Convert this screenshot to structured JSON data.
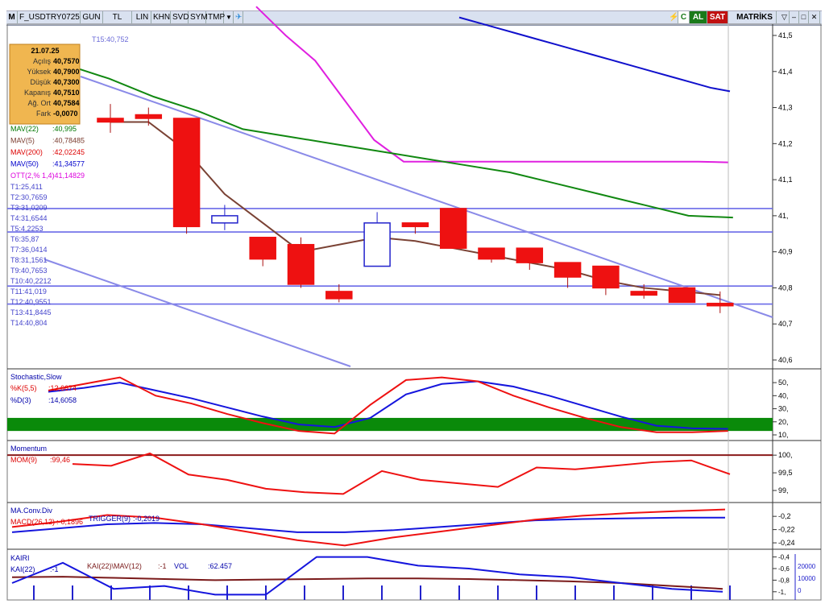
{
  "toolbar": {
    "m_label": "M",
    "symbol": "F_USDTRY0725",
    "period": "GUN",
    "currency": "TL",
    "buttons": [
      "LIN",
      "KHN",
      "SVD",
      "SYM",
      "TMP"
    ],
    "c_label": "C",
    "al_label": "AL",
    "sat_label": "SAT",
    "matriks_label": "MATRİKS",
    "colors": {
      "al": "#1a7a1a",
      "sat": "#c01010",
      "strip": "#d9e1f0"
    }
  },
  "info_box": {
    "date": "21.07.25",
    "rows": [
      {
        "label": "Açılış",
        "value": "40,7570"
      },
      {
        "label": "Yüksek",
        "value": "40,7900"
      },
      {
        "label": "Düşük",
        "value": "40,7300"
      },
      {
        "label": "Kapanış",
        "value": "40,7510"
      },
      {
        "label": "Ağ. Ort",
        "value": "40,7584"
      },
      {
        "label": "Fark",
        "value": "-0,0070"
      }
    ]
  },
  "price_panel": {
    "line_label": "T15:40,752",
    "indicator_labels": [
      {
        "text": "MAV(22)",
        "value": ":40,995",
        "color": "#007700"
      },
      {
        "text": "MAV(5)",
        "value": ":40,78485",
        "color": "#7a3b2e"
      },
      {
        "text": "MAV(200)",
        "value": ":42,02245",
        "color": "#dd0000"
      },
      {
        "text": "MAV(50)",
        "value": ":41,34577",
        "color": "#0000cc"
      },
      {
        "text": "OTT(2,% 1,4)",
        "value": ":41,14829",
        "color": "#dd00dd"
      }
    ],
    "t_levels": [
      "T1:25,411",
      "T2:30,7659",
      "T3:31,0209",
      "T4:31,6544",
      "T5:4,2253",
      "T6:35,87",
      "T7:36,0414",
      "T8:31,1561",
      "T9:40,7653",
      "T10:40,2212",
      "T11:41,019",
      "T12:40,9551",
      "T13:41,8445",
      "T14:40,804"
    ]
  },
  "stoch_panel": {
    "title": "Stochastic,Slow",
    "k_label": "%K(5,5)",
    "k_value": ":12,6674",
    "d_label": "%D(3)",
    "d_value": ":14,6058"
  },
  "mom_panel": {
    "title": "Momentum",
    "label": "MOM(9)",
    "value": ":99,46"
  },
  "macd_panel": {
    "title": "MA.Conv.Div",
    "macd_label": "MACD(26,12)",
    "macd_value": ":-0,1896",
    "trig_label": "TRIGGER(9)",
    "trig_value": ":-0,2019"
  },
  "kairi_panel": {
    "title": "KAIRI",
    "kai_label": "KAI(22)",
    "kai_value": ":-1",
    "kaimav_label": "KAI(22)\\MAV(12)",
    "kaimav_value": ":-1",
    "vol_label": "VOL",
    "vol_value": ":62.457"
  },
  "chart_data": [
    {
      "type": "candlestick",
      "yticks": [
        "41,5",
        "41,4",
        "41,3",
        "41,2",
        "41,1",
        "41,",
        "40,9",
        "40,8",
        "40,7",
        "40,6"
      ],
      "ylim": [
        40.585,
        41.52
      ],
      "candles": [
        {
          "open": 41.27,
          "high": 41.31,
          "low": 41.23,
          "close": 41.26
        },
        {
          "open": 41.28,
          "high": 41.3,
          "low": 41.25,
          "close": 41.27
        },
        {
          "open": 41.27,
          "high": 41.27,
          "low": 40.95,
          "close": 40.97
        },
        {
          "open": 40.98,
          "high": 41.03,
          "low": 40.96,
          "close": 41.0
        },
        {
          "open": 40.94,
          "high": 40.94,
          "low": 40.86,
          "close": 40.88
        },
        {
          "open": 40.92,
          "high": 40.94,
          "low": 40.8,
          "close": 40.81
        },
        {
          "open": 40.79,
          "high": 40.81,
          "low": 40.76,
          "close": 40.77
        },
        {
          "open": 40.86,
          "high": 41.01,
          "low": 40.86,
          "close": 40.98
        },
        {
          "open": 40.98,
          "high": 40.98,
          "low": 40.95,
          "close": 40.97
        },
        {
          "open": 41.02,
          "high": 41.02,
          "low": 40.91,
          "close": 40.91
        },
        {
          "open": 40.91,
          "high": 40.91,
          "low": 40.87,
          "close": 40.88
        },
        {
          "open": 40.91,
          "high": 40.91,
          "low": 40.85,
          "close": 40.87
        },
        {
          "open": 40.87,
          "high": 40.87,
          "low": 40.8,
          "close": 40.83
        },
        {
          "open": 40.86,
          "high": 40.86,
          "low": 40.78,
          "close": 40.8
        },
        {
          "open": 40.79,
          "high": 40.81,
          "low": 40.77,
          "close": 40.78
        },
        {
          "open": 40.8,
          "high": 40.8,
          "low": 40.76,
          "close": 40.76
        },
        {
          "open": 40.757,
          "high": 40.79,
          "low": 40.73,
          "close": 40.751
        }
      ],
      "mav5": [
        41.26,
        41.26,
        41.18,
        41.06,
        40.98,
        40.9,
        40.92,
        40.94,
        40.93,
        40.91,
        40.89,
        40.87,
        40.85,
        40.82,
        40.8,
        40.79,
        40.78
      ],
      "mav22": [
        41.44,
        41.42,
        41.38,
        41.33,
        41.29,
        41.24,
        41.22,
        41.2,
        41.18,
        41.16,
        41.14,
        41.12,
        41.09,
        41.06,
        41.03,
        41.0,
        40.995
      ],
      "ott": [
        41.58,
        41.5,
        41.43,
        41.32,
        41.21,
        41.15,
        41.15,
        41.15,
        41.15,
        41.15,
        41.15,
        41.15,
        41.15,
        41.15,
        41.15,
        41.15,
        41.148
      ],
      "mav50": [
        41.55,
        41.535,
        41.52,
        41.505,
        41.49,
        41.475,
        41.46,
        41.445,
        41.43,
        41.415,
        41.4,
        41.385,
        41.37,
        41.355,
        41.345
      ]
    },
    {
      "type": "line",
      "yticks": [
        "50,",
        "40,",
        "30,",
        "20,",
        "10,"
      ],
      "ylim": [
        10,
        55
      ],
      "k": [
        44,
        49,
        54,
        40,
        34,
        26,
        19,
        13,
        11,
        33,
        52,
        54,
        51,
        40,
        31,
        23,
        16,
        12,
        12,
        13
      ],
      "d": [
        43,
        46,
        50,
        44,
        38,
        31,
        24,
        18,
        16,
        23,
        41,
        49,
        51,
        47,
        40,
        32,
        24,
        17,
        15,
        14.6
      ]
    },
    {
      "type": "line",
      "yticks": [
        "100,",
        "99,5",
        "99,"
      ],
      "ylim": [
        98.75,
        100.3
      ],
      "mom": [
        99.75,
        99.7,
        100.05,
        99.45,
        99.3,
        99.05,
        98.95,
        98.9,
        99.55,
        99.3,
        99.2,
        99.1,
        99.65,
        99.6,
        99.7,
        99.8,
        99.85,
        99.46
      ],
      "ref": 100.0
    },
    {
      "type": "line",
      "yticks": [
        "-0,2",
        "-0,22",
        "-0,24"
      ],
      "ylim": [
        -0.246,
        -0.184
      ],
      "macd": [
        -0.216,
        -0.208,
        -0.198,
        -0.202,
        -0.212,
        -0.224,
        -0.236,
        -0.244,
        -0.232,
        -0.223,
        -0.214,
        -0.205,
        -0.199,
        -0.195,
        -0.192,
        -0.1896
      ],
      "trigger": [
        -0.224,
        -0.218,
        -0.212,
        -0.21,
        -0.212,
        -0.218,
        -0.224,
        -0.224,
        -0.221,
        -0.216,
        -0.211,
        -0.206,
        -0.204,
        -0.203,
        -0.202,
        -0.2019
      ]
    },
    {
      "type": "bar+line",
      "yticks": [
        "-0,4",
        "-0,6",
        "-0,8",
        "-1,"
      ],
      "vol_ticks": [
        "20000",
        "10000",
        "0"
      ],
      "kai": [
        -0.85,
        -0.5,
        -0.95,
        -0.9,
        -1.05,
        -1.05,
        -0.4,
        -0.4,
        -0.55,
        -0.6,
        -0.7,
        -0.75,
        -0.85,
        -0.95,
        -1.0
      ],
      "kaimav": [
        -0.75,
        -0.74,
        -0.76,
        -0.78,
        -0.8,
        -0.79,
        -0.78,
        -0.77,
        -0.77,
        -0.78,
        -0.8,
        -0.82,
        -0.85,
        -0.9,
        -0.95
      ]
    }
  ]
}
